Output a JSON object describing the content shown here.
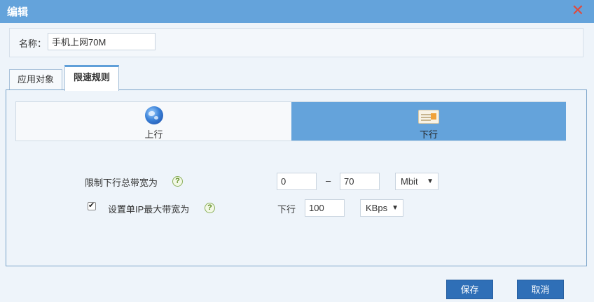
{
  "dialog": {
    "title": "编辑",
    "close_icon": "close-icon"
  },
  "name_field": {
    "label": "名称：",
    "value": "手机上网70M"
  },
  "tabs": [
    {
      "label": "应用对象",
      "active": false
    },
    {
      "label": "限速规则",
      "active": true
    }
  ],
  "direction": {
    "upstream": {
      "label": "上行",
      "icon": "globe-icon"
    },
    "downstream": {
      "label": "下行",
      "icon": "card-icon",
      "selected": true
    }
  },
  "rules": {
    "total_bandwidth": {
      "label": "限制下行总带宽为",
      "min_value": "0",
      "separator": "–",
      "max_value": "70",
      "unit": "Mbit"
    },
    "per_ip": {
      "checked": true,
      "label": "设置单IP最大带宽为",
      "direction_label": "下行",
      "value": "100",
      "unit": "KBps"
    },
    "help_text": "?"
  },
  "buttons": {
    "save": "保存",
    "cancel": "取消"
  },
  "colors": {
    "titlebar": "#64a3db",
    "selected_direction": "#64a3db",
    "button": "#2f6fb7",
    "close": "#e04a3c"
  }
}
